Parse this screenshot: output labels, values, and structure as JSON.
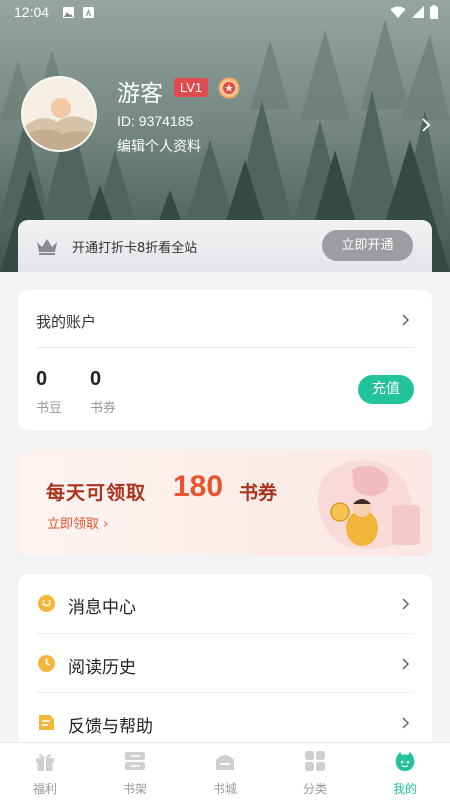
{
  "status_bar": {
    "time": "12:04"
  },
  "profile": {
    "username": "游客",
    "level_badge": "LV1",
    "user_id": "ID: 9374185",
    "edit_link": "编辑个人资料"
  },
  "vip_banner": {
    "text": "开通打折卡8折看全站",
    "button": "立即开通"
  },
  "account": {
    "title": "我的账户",
    "stats": [
      {
        "value": "0",
        "label": "书豆"
      },
      {
        "value": "0",
        "label": "书券"
      }
    ],
    "recharge_button": "充值"
  },
  "promo": {
    "headline_prefix": "每天可领取",
    "headline_number": "180",
    "headline_suffix": "书券",
    "link": "立即领取 ›"
  },
  "menu": [
    {
      "label": "消息中心",
      "icon": "message-icon"
    },
    {
      "label": "阅读历史",
      "icon": "history-clock-icon"
    },
    {
      "label": "反馈与帮助",
      "icon": "feedback-icon"
    }
  ],
  "tabbar": [
    {
      "label": "福利",
      "icon": "gift-icon",
      "active": false
    },
    {
      "label": "书架",
      "icon": "bookshelf-icon",
      "active": false
    },
    {
      "label": "书城",
      "icon": "bookstore-icon",
      "active": false
    },
    {
      "label": "分类",
      "icon": "category-grid-icon",
      "active": false
    },
    {
      "label": "我的",
      "icon": "profile-face-icon",
      "active": true
    }
  ],
  "colors": {
    "accent": "#22c39b",
    "level_badge": "#e14a4f",
    "promo_text": "#a8341d",
    "promo_number": "#e8532d",
    "vip_button": "#9c9ca1"
  }
}
